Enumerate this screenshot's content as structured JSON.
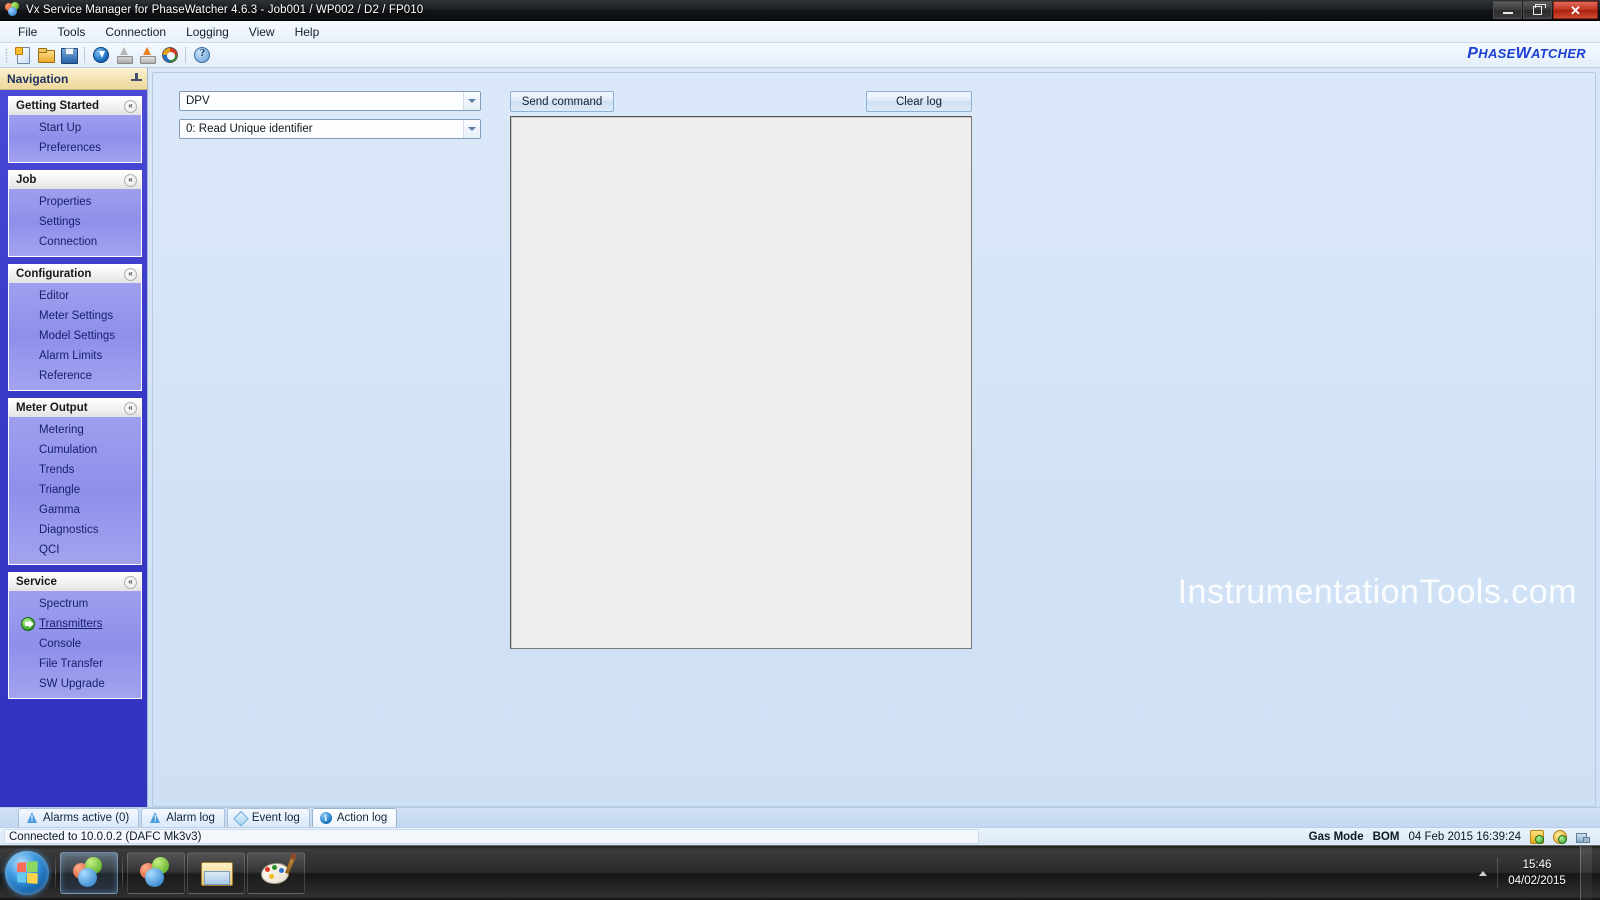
{
  "window": {
    "title": "Vx Service Manager for PhaseWatcher 4.6.3 - Job001 / WP002 / D2 / FP010",
    "minimize_label": "Minimize",
    "maximize_label": "Restore",
    "close_label": "Close"
  },
  "menu": {
    "items": [
      {
        "label": "File"
      },
      {
        "label": "Tools"
      },
      {
        "label": "Connection"
      },
      {
        "label": "Logging"
      },
      {
        "label": "View"
      },
      {
        "label": "Help"
      }
    ]
  },
  "toolbar": {
    "buttons": [
      {
        "icon": "new-document-icon",
        "tooltip": "New"
      },
      {
        "icon": "open-folder-icon",
        "tooltip": "Open"
      },
      {
        "icon": "save-disk-icon",
        "tooltip": "Save"
      },
      {
        "icon": "download-icon",
        "tooltip": "Download"
      },
      {
        "icon": "upload-disabled-icon",
        "tooltip": "Upload"
      },
      {
        "icon": "upload-icon",
        "tooltip": "Upload to meter"
      },
      {
        "icon": "refresh-icon",
        "tooltip": "Refresh"
      },
      {
        "icon": "help-icon",
        "tooltip": "Help"
      }
    ],
    "brand_upper_1": "P",
    "brand_rest_1": "HASE",
    "brand_upper_2": "W",
    "brand_rest_2": "ATCHER",
    "brand_full": "PhaseWatcher"
  },
  "sidebar": {
    "header": "Navigation",
    "pin_icon": "pin-icon",
    "groups": [
      {
        "title": "Getting Started",
        "collapse_glyph": "«",
        "items": [
          {
            "label": "Start Up",
            "active": false
          },
          {
            "label": "Preferences",
            "active": false
          }
        ]
      },
      {
        "title": "Job",
        "collapse_glyph": "«",
        "items": [
          {
            "label": "Properties",
            "active": false
          },
          {
            "label": "Settings",
            "active": false
          },
          {
            "label": "Connection",
            "active": false
          }
        ]
      },
      {
        "title": "Configuration",
        "collapse_glyph": "«",
        "items": [
          {
            "label": "Editor",
            "active": false
          },
          {
            "label": "Meter Settings",
            "active": false
          },
          {
            "label": "Model Settings",
            "active": false
          },
          {
            "label": "Alarm Limits",
            "active": false
          },
          {
            "label": "Reference",
            "active": false
          }
        ]
      },
      {
        "title": "Meter Output",
        "collapse_glyph": "«",
        "items": [
          {
            "label": "Metering",
            "active": false
          },
          {
            "label": "Cumulation",
            "active": false
          },
          {
            "label": "Trends",
            "active": false
          },
          {
            "label": "Triangle",
            "active": false
          },
          {
            "label": "Gamma",
            "active": false
          },
          {
            "label": "Diagnostics",
            "active": false
          },
          {
            "label": "QCI",
            "active": false
          }
        ]
      },
      {
        "title": "Service",
        "collapse_glyph": "«",
        "items": [
          {
            "label": "Spectrum",
            "active": false
          },
          {
            "label": "Transmitters",
            "active": true
          },
          {
            "label": "Console",
            "active": false
          },
          {
            "label": "File Transfer",
            "active": false
          },
          {
            "label": "SW Upgrade",
            "active": false
          }
        ]
      }
    ]
  },
  "main": {
    "device_combo": {
      "value": "DPV",
      "options": [
        "DPV"
      ]
    },
    "command_combo": {
      "value": "0: Read Unique identifier",
      "options": [
        "0: Read Unique identifier"
      ]
    },
    "send_button": "Send command",
    "clear_button": "Clear log",
    "log_text": "",
    "watermark": "InstrumentationTools.com"
  },
  "bottom_tabs": [
    {
      "label": "Alarms active (0)",
      "icon": "alarm-icon",
      "active": false
    },
    {
      "label": "Alarm log",
      "icon": "alarm-icon",
      "active": false
    },
    {
      "label": "Event log",
      "icon": "event-diamond-icon",
      "active": false
    },
    {
      "label": "Action log",
      "icon": "info-icon",
      "active": true
    }
  ],
  "statusbar": {
    "connection": "Connected to 10.0.0.2 (DAFC Mk3v3)",
    "gas_mode_label": "Gas Mode",
    "gas_mode_value": "BOM",
    "datetime": "04 Feb 2015 16:39:24"
  },
  "taskbar": {
    "start_label": "Start",
    "buttons": [
      {
        "name": "vx-service-manager-1",
        "icon": "phasewatcher-icon",
        "running": true
      },
      {
        "name": "vx-service-manager-2",
        "icon": "phasewatcher-icon",
        "running": false
      },
      {
        "name": "windows-explorer",
        "icon": "folder-icon",
        "running": false
      },
      {
        "name": "paint",
        "icon": "paint-icon",
        "running": false
      }
    ],
    "clock_time": "15:46",
    "clock_date": "04/02/2015"
  }
}
